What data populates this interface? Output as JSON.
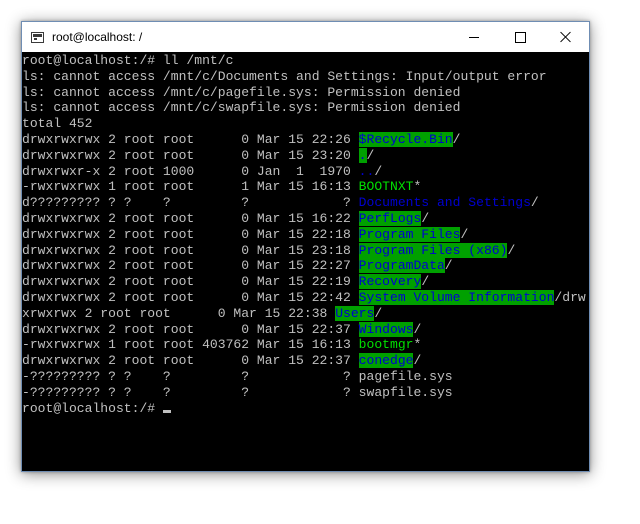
{
  "window": {
    "title": "root@localhost: /",
    "icon": "terminal-icon"
  },
  "terminal": {
    "colors": {
      "text": "#c0c0c0",
      "dir_fg": "#0000d0",
      "dir_bg": "#00a000",
      "exe_fg": "#00e000",
      "background": "#000000"
    },
    "lines": [
      [
        {
          "t": "root@localhost:/# ll /mnt/c"
        }
      ],
      [
        {
          "t": "ls: cannot access /mnt/c/Documents and Settings: Input/output error"
        }
      ],
      [
        {
          "t": "ls: cannot access /mnt/c/pagefile.sys: Permission denied"
        }
      ],
      [
        {
          "t": "ls: cannot access /mnt/c/swapfile.sys: Permission denied"
        }
      ],
      [
        {
          "t": "total 452"
        }
      ],
      [
        {
          "t": "drwxrwxrwx 2 root root      0 Mar 15 22:26 "
        },
        {
          "t": "$Recycle.Bin",
          "c": "dir"
        },
        {
          "t": "/"
        }
      ],
      [
        {
          "t": "drwxrwxrwx 2 root root      0 Mar 15 23:20 "
        },
        {
          "t": ".",
          "c": "dir"
        },
        {
          "t": "/"
        }
      ],
      [
        {
          "t": "drwxrwxr-x 2 root 1000      0 Jan  1  1970 "
        },
        {
          "t": "..",
          "c": "dir-plain"
        },
        {
          "t": "/"
        }
      ],
      [
        {
          "t": "-rwxrwxrwx 1 root root      1 Mar 15 16:13 "
        },
        {
          "t": "BOOTNXT",
          "c": "exe"
        },
        {
          "t": "*"
        }
      ],
      [
        {
          "t": "d????????? ? ?    ?         ?            ? "
        },
        {
          "t": "Documents and Settings",
          "c": "dir-plain"
        },
        {
          "t": "/"
        }
      ],
      [
        {
          "t": "drwxrwxrwx 2 root root      0 Mar 15 16:22 "
        },
        {
          "t": "PerfLogs",
          "c": "dir"
        },
        {
          "t": "/"
        }
      ],
      [
        {
          "t": "drwxrwxrwx 2 root root      0 Mar 15 22:18 "
        },
        {
          "t": "Program Files",
          "c": "dir"
        },
        {
          "t": "/"
        }
      ],
      [
        {
          "t": "drwxrwxrwx 2 root root      0 Mar 15 23:18 "
        },
        {
          "t": "Program Files (x86)",
          "c": "dir"
        },
        {
          "t": "/"
        }
      ],
      [
        {
          "t": "drwxrwxrwx 2 root root      0 Mar 15 22:27 "
        },
        {
          "t": "ProgramData",
          "c": "dir"
        },
        {
          "t": "/"
        }
      ],
      [
        {
          "t": "drwxrwxrwx 2 root root      0 Mar 15 22:19 "
        },
        {
          "t": "Recovery",
          "c": "dir"
        },
        {
          "t": "/"
        }
      ],
      [
        {
          "t": "drwxrwxrwx 2 root root      0 Mar 15 22:42 "
        },
        {
          "t": "System Volume Information",
          "c": "dir"
        },
        {
          "t": "/drw"
        }
      ],
      [
        {
          "t": "xrwxrwx 2 root root      0 Mar 15 22:38 "
        },
        {
          "t": "Users",
          "c": "dir"
        },
        {
          "t": "/"
        }
      ],
      [
        {
          "t": "drwxrwxrwx 2 root root      0 Mar 15 22:37 "
        },
        {
          "t": "Windows",
          "c": "dir"
        },
        {
          "t": "/"
        }
      ],
      [
        {
          "t": "-rwxrwxrwx 1 root root 403762 Mar 15 16:13 "
        },
        {
          "t": "bootmgr",
          "c": "exe"
        },
        {
          "t": "*"
        }
      ],
      [
        {
          "t": "drwxrwxrwx 2 root root      0 Mar 15 22:37 "
        },
        {
          "t": "conedge",
          "c": "dir"
        },
        {
          "t": "/"
        }
      ],
      [
        {
          "t": "-????????? ? ?    ?         ?            ? pagefile.sys"
        }
      ],
      [
        {
          "t": "-????????? ? ?    ?         ?            ? swapfile.sys"
        }
      ],
      [
        {
          "t": "root@localhost:/# "
        },
        {
          "t": "",
          "c": "cursor"
        }
      ]
    ]
  }
}
